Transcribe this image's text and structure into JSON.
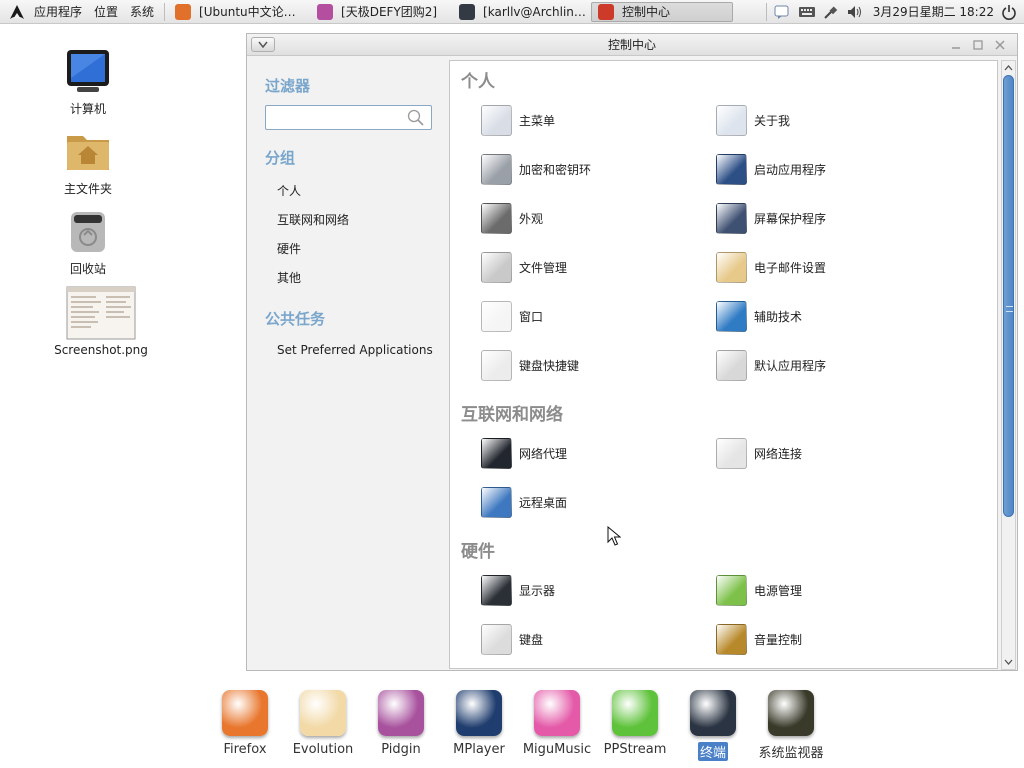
{
  "top_panel": {
    "menus": [
      "应用程序",
      "位置",
      "系统"
    ],
    "tasks": [
      {
        "label": "[Ubuntu中文论…",
        "icon": "firefox-icon",
        "color": "#e0702a",
        "active": false
      },
      {
        "label": "[天极DEFY团购2]",
        "icon": "pidgin-icon",
        "color": "#b44fa0",
        "active": false
      },
      {
        "label": "[karllv@Archlin…",
        "icon": "terminal-icon",
        "color": "#333a44",
        "active": false
      },
      {
        "label": "控制中心",
        "icon": "control-center-icon",
        "color": "#cc3a2a",
        "active": true
      }
    ],
    "clock": "3月29日星期二 18:22"
  },
  "desktop_icons": [
    {
      "label": "计算机",
      "icon": "computer-icon"
    },
    {
      "label": "主文件夹",
      "icon": "home-folder-icon"
    },
    {
      "label": "回收站",
      "icon": "trash-icon"
    },
    {
      "label": "Screenshot.png",
      "icon": "image-file-icon"
    }
  ],
  "window": {
    "title": "控制中心",
    "filter": {
      "heading": "过滤器",
      "search_value": "",
      "search_placeholder": ""
    },
    "groups": {
      "heading": "分组",
      "items": [
        "个人",
        "互联网和网络",
        "硬件",
        "其他"
      ]
    },
    "tasks": {
      "heading": "公共任务",
      "items": [
        "Set Preferred Applications"
      ]
    },
    "categories": [
      {
        "title": "个人",
        "items": [
          {
            "label": "主菜单",
            "icon": "main-menu-icon",
            "color": "#d9dde6"
          },
          {
            "label": "关于我",
            "icon": "about-me-icon",
            "color": "#dde4ee"
          },
          {
            "label": "加密和密钥环",
            "icon": "keyring-icon",
            "color": "#9aa0a8"
          },
          {
            "label": "启动应用程序",
            "icon": "startup-apps-icon",
            "color": "#2c4f86"
          },
          {
            "label": "外观",
            "icon": "appearance-icon",
            "color": "#6b6b6b"
          },
          {
            "label": "屏幕保护程序",
            "icon": "screensaver-icon",
            "color": "#3f5173"
          },
          {
            "label": "文件管理",
            "icon": "file-management-icon",
            "color": "#c9c9c9"
          },
          {
            "label": "电子邮件设置",
            "icon": "email-settings-icon",
            "color": "#e7c98a"
          },
          {
            "label": "窗口",
            "icon": "windows-icon",
            "color": "#f5f5f5"
          },
          {
            "label": "辅助技术",
            "icon": "accessibility-icon",
            "color": "#2f7bc4"
          },
          {
            "label": "键盘快捷键",
            "icon": "keyboard-shortcuts-icon",
            "color": "#ececec"
          },
          {
            "label": "默认应用程序",
            "icon": "default-apps-icon",
            "color": "#d8d8d8"
          }
        ]
      },
      {
        "title": "互联网和网络",
        "items": [
          {
            "label": "网络代理",
            "icon": "network-proxy-icon",
            "color": "#22262e"
          },
          {
            "label": "网络连接",
            "icon": "network-connection-icon",
            "color": "#e5e5e5"
          },
          {
            "label": "远程桌面",
            "icon": "remote-desktop-icon",
            "color": "#3d78c0"
          }
        ]
      },
      {
        "title": "硬件",
        "items": [
          {
            "label": "显示器",
            "icon": "display-icon",
            "color": "#2b2f36"
          },
          {
            "label": "电源管理",
            "icon": "power-management-icon",
            "color": "#7dc14a"
          },
          {
            "label": "键盘",
            "icon": "keyboard-icon",
            "color": "#dcdcdc"
          },
          {
            "label": "音量控制",
            "icon": "volume-control-icon",
            "color": "#b8892a"
          }
        ]
      }
    ]
  },
  "dock": [
    {
      "label": "Firefox",
      "icon": "firefox-icon",
      "color": "#e8762d",
      "active": false
    },
    {
      "label": "Evolution",
      "icon": "evolution-icon",
      "color": "#f2d9a6",
      "active": false
    },
    {
      "label": "Pidgin",
      "icon": "pidgin-icon",
      "color": "#a8529e",
      "active": false
    },
    {
      "label": "MPlayer",
      "icon": "mplayer-icon",
      "color": "#1f3d6e",
      "active": false
    },
    {
      "label": "MiguMusic",
      "icon": "migumusic-icon",
      "color": "#e45aa8",
      "active": false
    },
    {
      "label": "PPStream",
      "icon": "ppstream-icon",
      "color": "#5ec23a",
      "active": false
    },
    {
      "label": "终端",
      "icon": "terminal-icon",
      "color": "#2a3442",
      "active": true
    },
    {
      "label": "系统监视器",
      "icon": "system-monitor-icon",
      "color": "#3a3a2a",
      "active": false
    }
  ]
}
